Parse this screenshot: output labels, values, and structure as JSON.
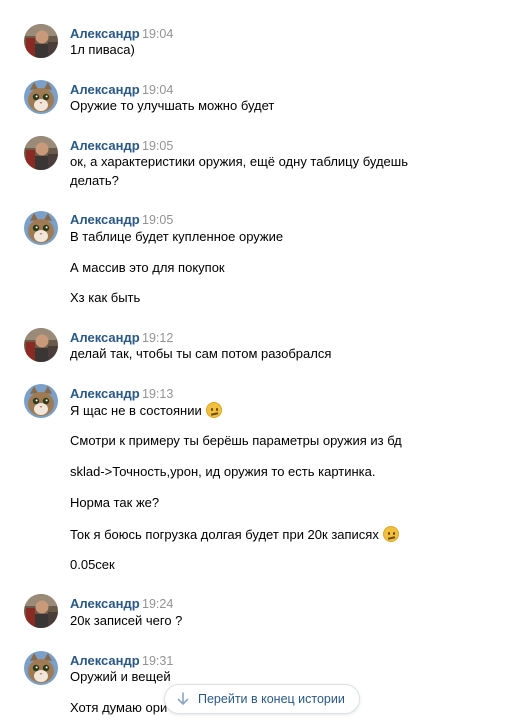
{
  "icons": {
    "avatar_a": "man-photo-avatar",
    "avatar_b": "cat-avatar",
    "emoji": "confused-face-emoji",
    "arrow": "arrow-down-icon"
  },
  "colors": {
    "author": "#2a5885",
    "time": "#939393",
    "text": "#000000",
    "emoji": "#f2c03c"
  },
  "messages": [
    {
      "author": "Александр",
      "time": "19:04",
      "avatar": "man",
      "lines": [
        {
          "text": "1л пиваса)"
        }
      ]
    },
    {
      "author": "Александр",
      "time": "19:04",
      "avatar": "cat",
      "lines": [
        {
          "text": "Оружие то улучшать можно будет"
        }
      ]
    },
    {
      "author": "Александр",
      "time": "19:05",
      "avatar": "man",
      "lines": [
        {
          "text": "ок, а характеристики оружия, ещё одну таблицу будешь"
        },
        {
          "text": "делать?"
        }
      ]
    },
    {
      "author": "Александр",
      "time": "19:05",
      "avatar": "cat",
      "lines": [
        {
          "text": "В таблице будет купленное оружие"
        },
        {
          "text": "А массив это для покупок"
        },
        {
          "text": "Хз как быть"
        }
      ]
    },
    {
      "author": "Александр",
      "time": "19:12",
      "avatar": "man",
      "lines": [
        {
          "text": "делай так, чтобы ты сам потом разобрался"
        }
      ]
    },
    {
      "author": "Александр",
      "time": "19:13",
      "avatar": "cat",
      "lines": [
        {
          "text": "Я щас не в состоянии",
          "emoji": true
        },
        {
          "text": "Смотри к примеру ты берёшь параметры оружия из бд"
        },
        {
          "text": "sklad->Точность,урон, ид оружия то есть картинка."
        },
        {
          "text": "Норма так же?"
        },
        {
          "text": "Ток я боюсь погрузка долгая будет при 20к записях",
          "emoji": true
        },
        {
          "text": "0.05сек"
        }
      ]
    },
    {
      "author": "Александр",
      "time": "19:24",
      "avatar": "man",
      "lines": [
        {
          "text": "20к записей чего ?"
        }
      ]
    },
    {
      "author": "Александр",
      "time": "19:31",
      "avatar": "cat",
      "lines": [
        {
          "text": "Оружий и вещей"
        },
        {
          "text": "Хотя думаю ори"
        }
      ]
    }
  ],
  "jump_button": {
    "label": "Перейти в конец истории"
  }
}
